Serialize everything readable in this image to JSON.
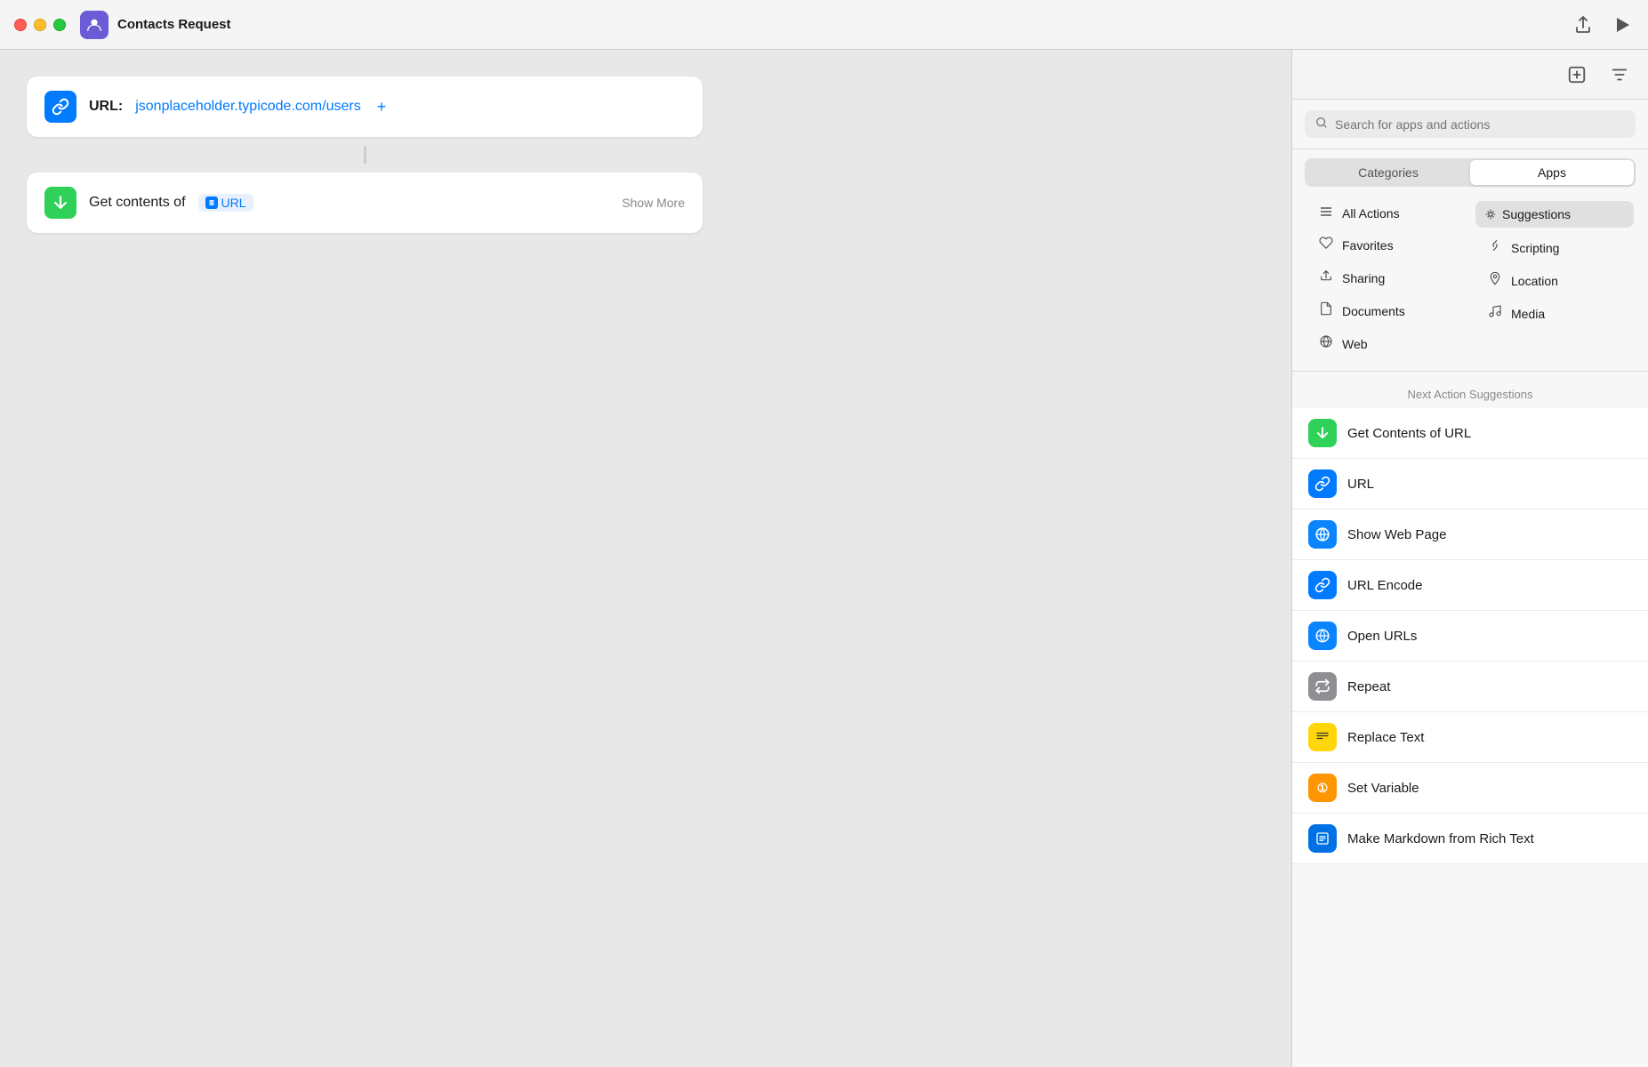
{
  "titleBar": {
    "title": "Contacts Request",
    "appIcon": "👤"
  },
  "canvas": {
    "urlCard": {
      "label": "URL:",
      "value": "jsonplaceholder.typicode.com/users",
      "plus": "+"
    },
    "actionCard": {
      "label": "Get contents of",
      "token": "URL",
      "showMore": "Show More"
    }
  },
  "sidebar": {
    "searchPlaceholder": "Search for apps and actions",
    "tabs": [
      {
        "label": "Categories",
        "active": false
      },
      {
        "label": "Apps",
        "active": true
      }
    ],
    "allActionsLabel": "All Actions",
    "suggestionsLabel": "Suggestions",
    "categories": [
      {
        "icon": "≡",
        "label": "All Actions"
      },
      {
        "icon": "♡",
        "label": "Favorites"
      },
      {
        "icon": "⬆",
        "label": "Sharing"
      },
      {
        "icon": "📄",
        "label": "Documents"
      },
      {
        "icon": "◉",
        "label": "Web"
      },
      {
        "icon": "🔗",
        "label": "Scripting"
      },
      {
        "icon": "📍",
        "label": "Location"
      },
      {
        "icon": "♪",
        "label": "Media"
      }
    ],
    "nextActionSuggestions": {
      "title": "Next Action Suggestions",
      "items": [
        {
          "label": "Get Contents of URL",
          "iconColor": "green",
          "iconText": "⬇"
        },
        {
          "label": "URL",
          "iconColor": "blue",
          "iconText": "🔗"
        },
        {
          "label": "Show Web Page",
          "iconColor": "blue-dark",
          "iconText": "◉"
        },
        {
          "label": "URL Encode",
          "iconColor": "blue",
          "iconText": "🔗"
        },
        {
          "label": "Open URLs",
          "iconColor": "blue-dark",
          "iconText": "◉"
        },
        {
          "label": "Repeat",
          "iconColor": "gray",
          "iconText": "⟳"
        },
        {
          "label": "Replace Text",
          "iconColor": "yellow",
          "iconText": "≡"
        },
        {
          "label": "Set Variable",
          "iconColor": "orange",
          "iconText": "①"
        },
        {
          "label": "Make Markdown from Rich Text",
          "iconColor": "blue2",
          "iconText": "📋"
        }
      ]
    }
  }
}
